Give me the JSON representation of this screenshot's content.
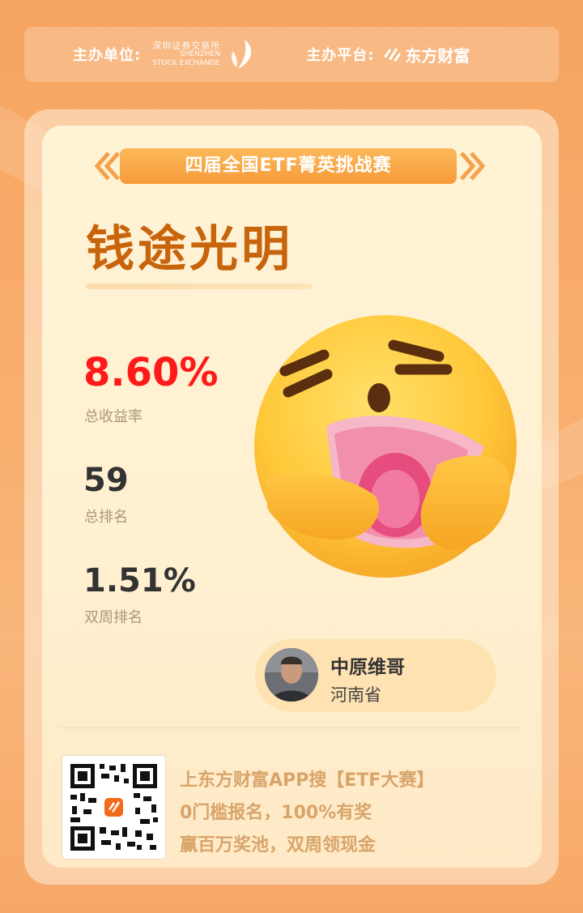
{
  "header": {
    "host_label": "主办单位:",
    "szse_name_cn": "深圳证券交易所",
    "szse_name_en1": "SHENZHEN",
    "szse_name_en2": "STOCK EXCHANGE",
    "platform_label": "主办平台:",
    "platform_name": "东方财富"
  },
  "banner": {
    "text": "四届全国ETF菁英挑战赛"
  },
  "title": "钱途光明",
  "stats": [
    {
      "value": "8.60%",
      "label": "总收益率",
      "color": "#ff1a1a"
    },
    {
      "value": "59",
      "label": "总排名"
    },
    {
      "value": "1.51%",
      "label": "双周排名"
    }
  ],
  "user": {
    "name": "中原维哥",
    "region": "河南省"
  },
  "footer": {
    "lines": [
      "上东方财富APP搜【ETF大赛】",
      "0门槛报名，100%有奖",
      "赢百万奖池，双周领现金"
    ]
  },
  "colors": {
    "accent": "#c8650c",
    "banner": "#f79a3a",
    "background": "#f7a868",
    "promo": "#d8a46a"
  },
  "icons": {
    "szse": "szse-leaf-logo-icon",
    "platform": "eastmoney-logo-icon",
    "emoji": "money-hug-emoji-icon",
    "qr": "qr-code-icon"
  }
}
